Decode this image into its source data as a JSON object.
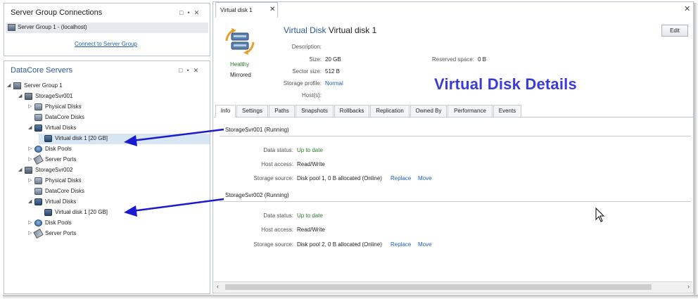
{
  "connections_panel": {
    "title": "Server Group Connections",
    "controls": [
      "□",
      "•",
      "✕"
    ],
    "server_group": "Server Group 1 - (localhost)",
    "connect_link": "Connect to Server Group"
  },
  "servers_panel": {
    "title": "DataCore Servers",
    "controls": [
      "□",
      "•",
      "✕"
    ],
    "tree": [
      {
        "label": "Server Group 1",
        "icon": "server-group-icon",
        "toggle": "◢"
      },
      {
        "label": "StorageSvr001",
        "icon": "server-icon",
        "toggle": "◢"
      },
      {
        "label": "Physical Disks",
        "icon": "physical-disks-icon",
        "toggle": "▷"
      },
      {
        "label": "DataCore Disks",
        "icon": "datacore-disks-icon",
        "toggle": ""
      },
      {
        "label": "Virtual Disks",
        "icon": "virtual-disks-icon",
        "toggle": "◢"
      },
      {
        "label": "Virtual disk 1   [20 GB]",
        "icon": "virtual-disk-icon",
        "toggle": ""
      },
      {
        "label": "Disk Pools",
        "icon": "disk-pool-icon",
        "toggle": "▷"
      },
      {
        "label": "Server Ports",
        "icon": "server-ports-icon",
        "toggle": "▷"
      },
      {
        "label": "StorageSvr002",
        "icon": "server-icon",
        "toggle": "◢"
      },
      {
        "label": "Physical Disks",
        "icon": "physical-disks-icon",
        "toggle": "▷"
      },
      {
        "label": "DataCore Disks",
        "icon": "datacore-disks-icon",
        "toggle": ""
      },
      {
        "label": "Virtual Disks",
        "icon": "virtual-disks-icon",
        "toggle": "◢"
      },
      {
        "label": "Virtual disk 1   [20 GB]",
        "icon": "virtual-disk-icon",
        "toggle": ""
      },
      {
        "label": "Disk Pools",
        "icon": "disk-pool-icon",
        "toggle": "▷"
      },
      {
        "label": "Server Ports",
        "icon": "server-ports-icon",
        "toggle": "▷"
      }
    ]
  },
  "document_tab": {
    "label": "Virtual disk 1",
    "close": "✕"
  },
  "main": {
    "close": "✕",
    "title_kind": "Virtual Disk",
    "title_name": "Virtual disk 1",
    "edit_button": "Edit",
    "health": "Healthy",
    "mirror_state": "Mirrored",
    "props": {
      "description_label": "Description:",
      "description_value": "",
      "size_label": "Size:",
      "size_value": "20 GB",
      "sector_label": "Sector size:",
      "sector_value": "512 B",
      "profile_label": "Storage profile:",
      "profile_value": "Normal",
      "hosts_label": "Host(s):",
      "hosts_value": "",
      "reserved_label": "Reserved space:",
      "reserved_value": "0 B"
    },
    "annotation": "Virtual Disk Details",
    "tabs": [
      "Info",
      "Settings",
      "Paths",
      "Snapshots",
      "Rollbacks",
      "Replication",
      "Owned By",
      "Performance",
      "Events"
    ],
    "active_tab": "Info",
    "sections": [
      {
        "title": "StorageSvr001 (Running)",
        "data_status_label": "Data status:",
        "data_status_value": "Up to date",
        "host_access_label": "Host access:",
        "host_access_value": "Read/Write",
        "source_label": "Storage source:",
        "source_value": "Disk pool 1, 0 B allocated (Online)",
        "replace": "Replace",
        "move": "Move"
      },
      {
        "title": "StorageSvr002 (Running)",
        "data_status_label": "Data status:",
        "data_status_value": "Up to date",
        "host_access_label": "Host access:",
        "host_access_value": "Read/Write",
        "source_label": "Storage source:",
        "source_value": "Disk pool 2, 0 B allocated (Online)",
        "replace": "Replace",
        "move": "Move"
      }
    ]
  },
  "scrollbar": {
    "left": "‹",
    "right": "›"
  },
  "colors": {
    "accent": "#1e5fb4",
    "annotation": "#3b3bd8",
    "arrow": "#1a1ad0",
    "ok": "#2b7a2b"
  }
}
